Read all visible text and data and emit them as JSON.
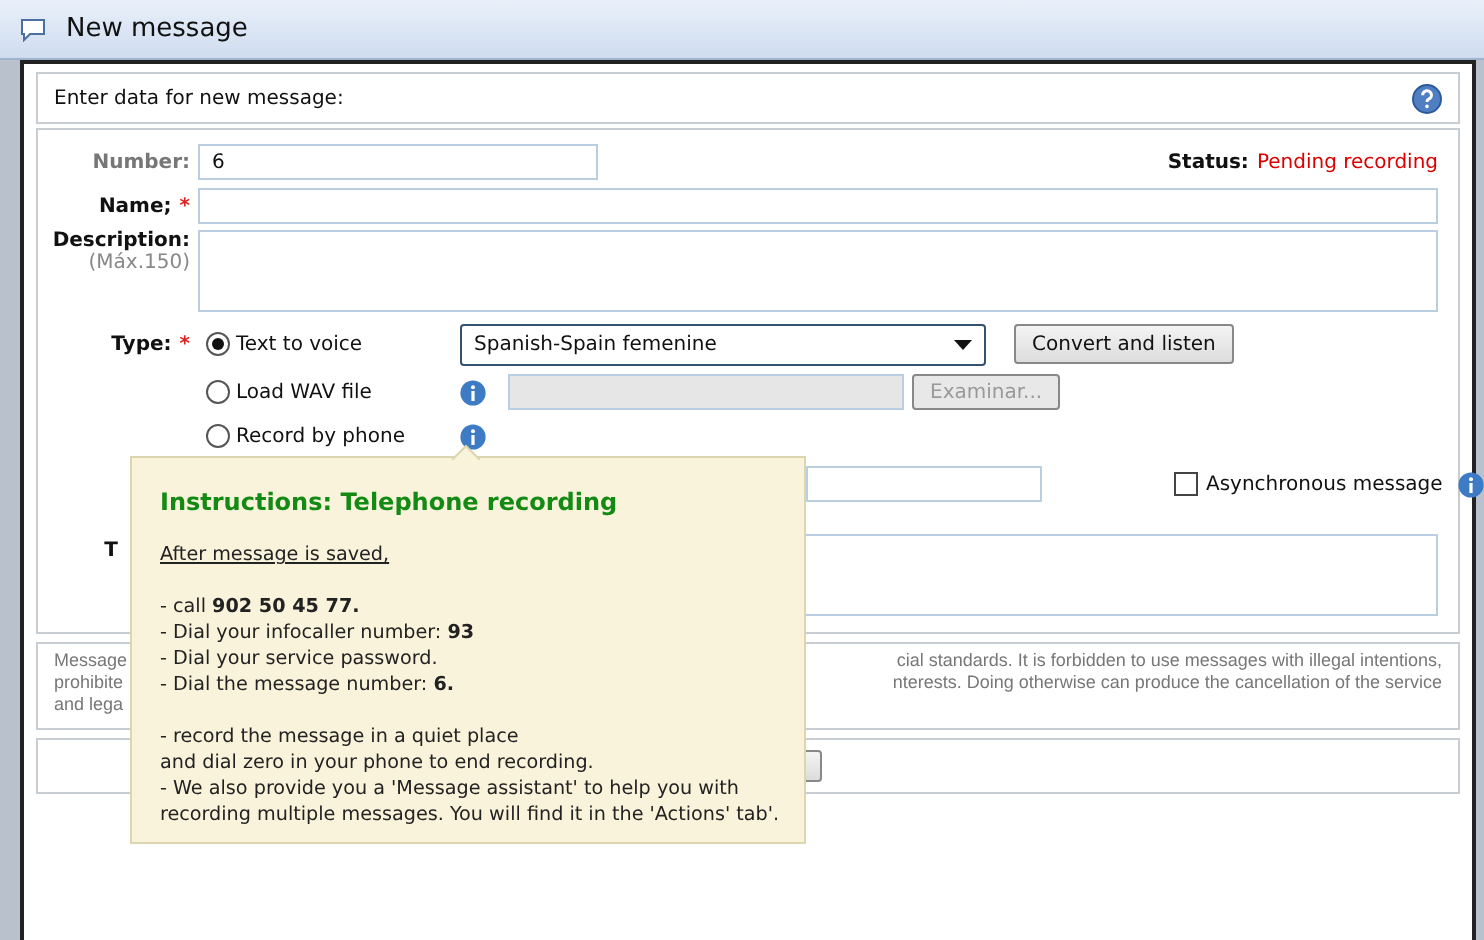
{
  "window": {
    "title": "New message"
  },
  "header": {
    "text": "Enter data for new message:"
  },
  "form": {
    "number": {
      "label": "Number:",
      "value": "6"
    },
    "status": {
      "label": "Status:",
      "value": "Pending recording"
    },
    "name": {
      "label": "Name;",
      "required_mark": "*"
    },
    "description": {
      "label": "Description:",
      "hint": "(Máx.150)"
    },
    "type": {
      "label": "Type:",
      "required_mark": "*",
      "options": [
        {
          "label": "Text to voice",
          "selected": true,
          "info_icon": false
        },
        {
          "label": "Load WAV file",
          "selected": false,
          "info_icon": true
        },
        {
          "label": "Record by phone",
          "selected": false,
          "info_icon": true
        }
      ],
      "voice": {
        "value": "Spanish-Spain femenine"
      },
      "convert_button": "Convert and listen",
      "browse_button": {
        "label": "Examinar...",
        "disabled": true
      }
    },
    "asynchronous": {
      "label": "Asynchronous message",
      "checked": false
    },
    "text_label": "T"
  },
  "notice": {
    "lines": [
      {
        "left": "Message",
        "right": "cial standards. It is forbidden to use messages with illegal intentions,"
      },
      {
        "left": "prohibite",
        "right": "nterests. Doing otherwise can produce the cancellation of the service"
      },
      {
        "left": "and lega"
      }
    ]
  },
  "tooltip": {
    "title": "Instructions: Telephone recording",
    "intro": "After message is saved,",
    "paragraphs": [
      [
        "- call **902 50 45 77.**",
        "- Dial your infocaller number: **93**",
        "- Dial your service password.",
        "- Dial the message number: **6.**"
      ],
      [
        "- record the message in a quiet place",
        "and dial zero in your phone to end recording.",
        "- We also provide you a 'Message assistant' to help you with",
        "recording multiple messages. You will find it in the 'Actions' tab'."
      ]
    ]
  }
}
